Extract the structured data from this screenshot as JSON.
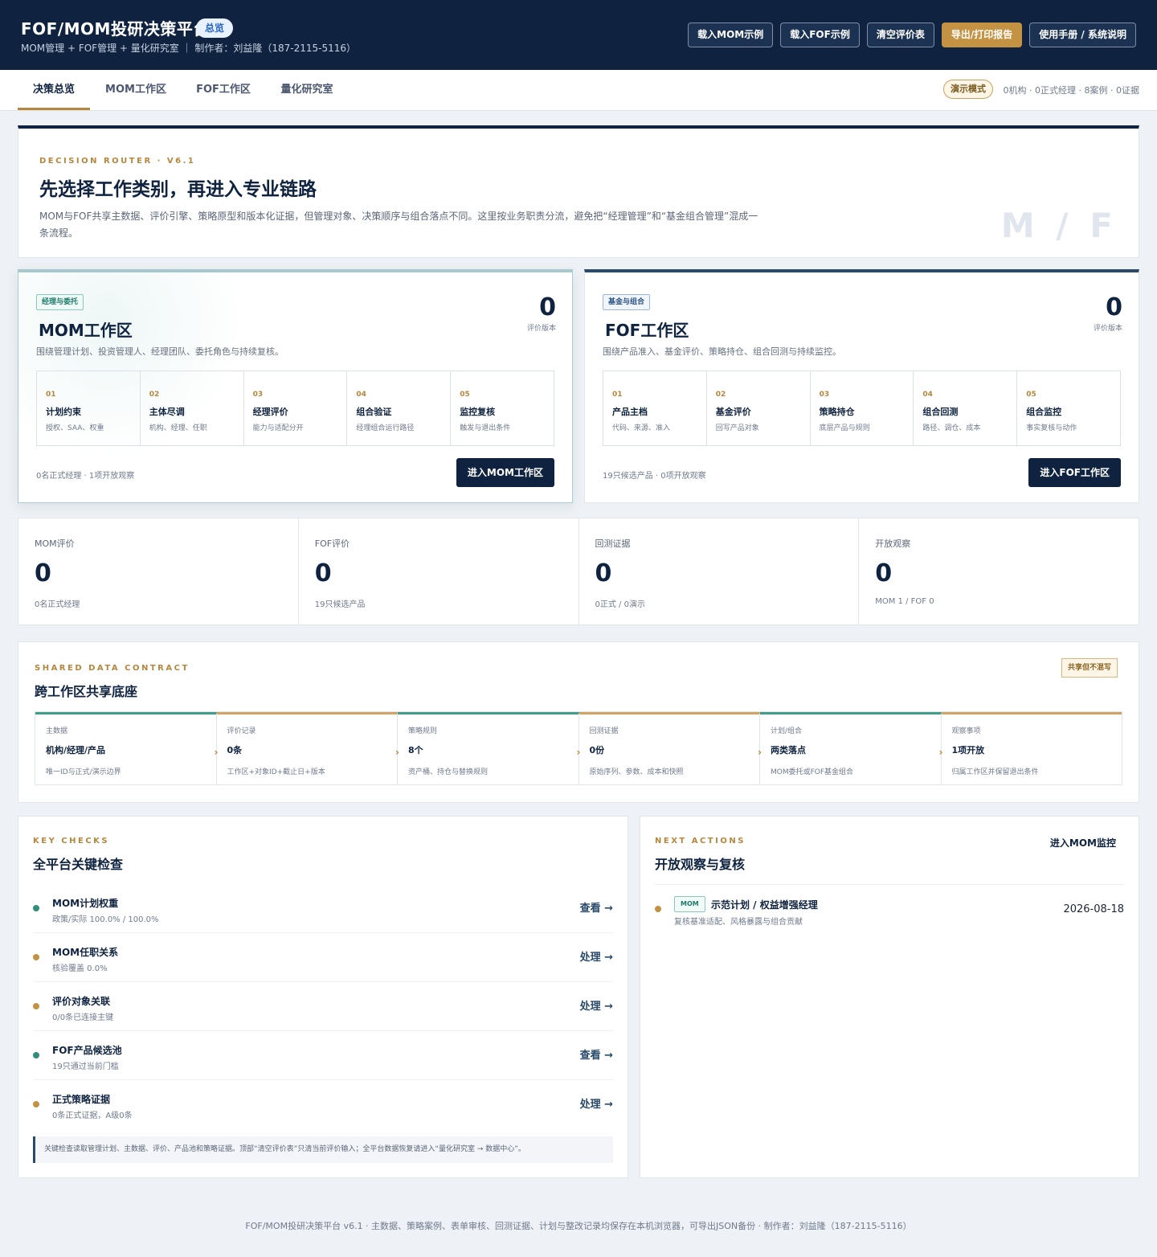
{
  "header": {
    "title": "FOF/MOM投研决策平台",
    "badge": "总览",
    "subtitle": "MOM管理 + FOF管理 + 量化研究室 ｜ 制作者：刘益隆（187-2115-5116）",
    "buttons": [
      "载入MOM示例",
      "载入FOF示例",
      "清空评价表",
      "导出/打印报告",
      "使用手册 / 系统说明"
    ]
  },
  "tabs": [
    "决策总览",
    "MOM工作区",
    "FOF工作区",
    "量化研究室"
  ],
  "mode": {
    "label": "演示模式",
    "info": "0机构 · 0正式经理 · 8案例 · 0证据"
  },
  "router": {
    "eyebrow": "DECISION ROUTER · V6.1",
    "title": "先选择工作类别，再进入专业链路",
    "desc": "MOM与FOF共享主数据、评价引擎、策略原型和版本化证据，但管理对象、决策顺序与组合落点不同。这里按业务职责分流，避免把“经理管理”和“基金组合管理”混成一条流程。",
    "mark": "M / F"
  },
  "mom": {
    "tag": "经理与委托",
    "title": "MOM工作区",
    "desc": "围绕管理计划、投资管理人、经理团队、委托角色与持续复核。",
    "count": "0",
    "count_label": "评价版本",
    "steps": [
      {
        "n": "01",
        "t": "计划约束",
        "s": "授权、SAA、权重"
      },
      {
        "n": "02",
        "t": "主体尽调",
        "s": "机构、经理、任职"
      },
      {
        "n": "03",
        "t": "经理评价",
        "s": "能力与适配分开"
      },
      {
        "n": "04",
        "t": "组合验证",
        "s": "经理组合运行路径"
      },
      {
        "n": "05",
        "t": "监控复核",
        "s": "触发与退出条件"
      }
    ],
    "foot": "0名正式经理 · 1项开放观察",
    "cta": "进入MOM工作区"
  },
  "fof": {
    "tag": "基金与组合",
    "title": "FOF工作区",
    "desc": "围绕产品准入、基金评价、策略持仓、组合回测与持续监控。",
    "count": "0",
    "count_label": "评价版本",
    "steps": [
      {
        "n": "01",
        "t": "产品主档",
        "s": "代码、来源、准入"
      },
      {
        "n": "02",
        "t": "基金评价",
        "s": "回写产品对象"
      },
      {
        "n": "03",
        "t": "策略持仓",
        "s": "底层产品与规则"
      },
      {
        "n": "04",
        "t": "组合回测",
        "s": "路径、调仓、成本"
      },
      {
        "n": "05",
        "t": "组合监控",
        "s": "事实复核与动作"
      }
    ],
    "foot": "19只候选产品 · 0项开放观察",
    "cta": "进入FOF工作区"
  },
  "stats": [
    {
      "label": "MOM评价",
      "value": "0",
      "sub": "0名正式经理"
    },
    {
      "label": "FOF评价",
      "value": "0",
      "sub": "19只候选产品"
    },
    {
      "label": "回测证据",
      "value": "0",
      "sub": "0正式 / 0演示"
    },
    {
      "label": "开放观察",
      "value": "0",
      "sub": "MOM 1 / FOF 0"
    }
  ],
  "shared": {
    "eyebrow": "SHARED DATA CONTRACT",
    "title": "跨工作区共享底座",
    "chip": "共享但不混写",
    "cells": [
      {
        "k": "主数据",
        "b": "机构/经理/产品",
        "d": "唯一ID与正式/演示边界"
      },
      {
        "k": "评价记录",
        "b": "0条",
        "d": "工作区+对象ID+截止日+版本"
      },
      {
        "k": "策略规则",
        "b": "8个",
        "d": "资产桶、持仓与替换规则"
      },
      {
        "k": "回测证据",
        "b": "0份",
        "d": "原始序列、参数、成本和快照"
      },
      {
        "k": "计划/组合",
        "b": "两类落点",
        "d": "MOM委托或FOF基金组合"
      },
      {
        "k": "观察事项",
        "b": "1项开放",
        "d": "归属工作区并保留退出条件"
      }
    ]
  },
  "checks": {
    "eyebrow": "KEY CHECKS",
    "title": "全平台关键检查",
    "items": [
      {
        "t": "MOM计划权重",
        "d": "政策/实际 100.0% / 100.0%",
        "a": "查看 →",
        "color": "#2f8f7a"
      },
      {
        "t": "MOM任职关系",
        "d": "核验覆盖 0.0%",
        "a": "处理 →",
        "color": "#c39243"
      },
      {
        "t": "评价对象关联",
        "d": "0/0条已连接主键",
        "a": "处理 →",
        "color": "#c39243"
      },
      {
        "t": "FOF产品候选池",
        "d": "19只通过当前门槛",
        "a": "查看 →",
        "color": "#2f8f7a"
      },
      {
        "t": "正式策略证据",
        "d": "0条正式证据，A级0条",
        "a": "处理 →",
        "color": "#c39243"
      }
    ],
    "note": "关键检查读取管理计划、主数据、评价、产品池和策略证据。顶部“清空评价表”只清当前评价输入；全平台数据恢复请进入“量化研究室 → 数据中心”。"
  },
  "actions": {
    "eyebrow": "NEXT ACTIONS",
    "title": "开放观察与复核",
    "link": "进入MOM监控",
    "item": {
      "tag": "MOM",
      "t": "示范计划 / 权益增强经理",
      "d": "复核基准适配、风格暴露与组合贡献",
      "date": "2026-08-18"
    }
  },
  "footer": "FOF/MOM投研决策平台 v6.1 · 主数据、策略案例、表单审核、回测证据、计划与整改记录均保存在本机浏览器，可导出JSON备份 · 制作者：刘益隆（187-2115-5116）"
}
